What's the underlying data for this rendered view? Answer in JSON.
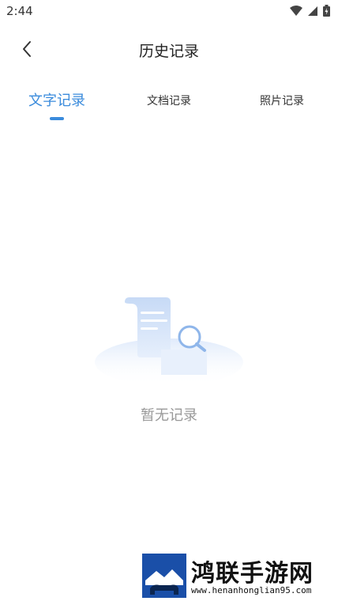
{
  "status_bar": {
    "time": "2:44"
  },
  "header": {
    "title": "历史记录",
    "back_icon": "chevron-left-icon"
  },
  "tabs": [
    {
      "label": "文字记录",
      "active": true
    },
    {
      "label": "文档记录",
      "active": false
    },
    {
      "label": "照片记录",
      "active": false
    }
  ],
  "empty_state": {
    "message": "暂无记录",
    "icon": "document-search-icon"
  },
  "watermark": {
    "title": "鸿联手游网",
    "url": "www.henanhonglian95.com"
  },
  "colors": {
    "accent": "#3a8bdc",
    "muted_text": "#999999"
  }
}
